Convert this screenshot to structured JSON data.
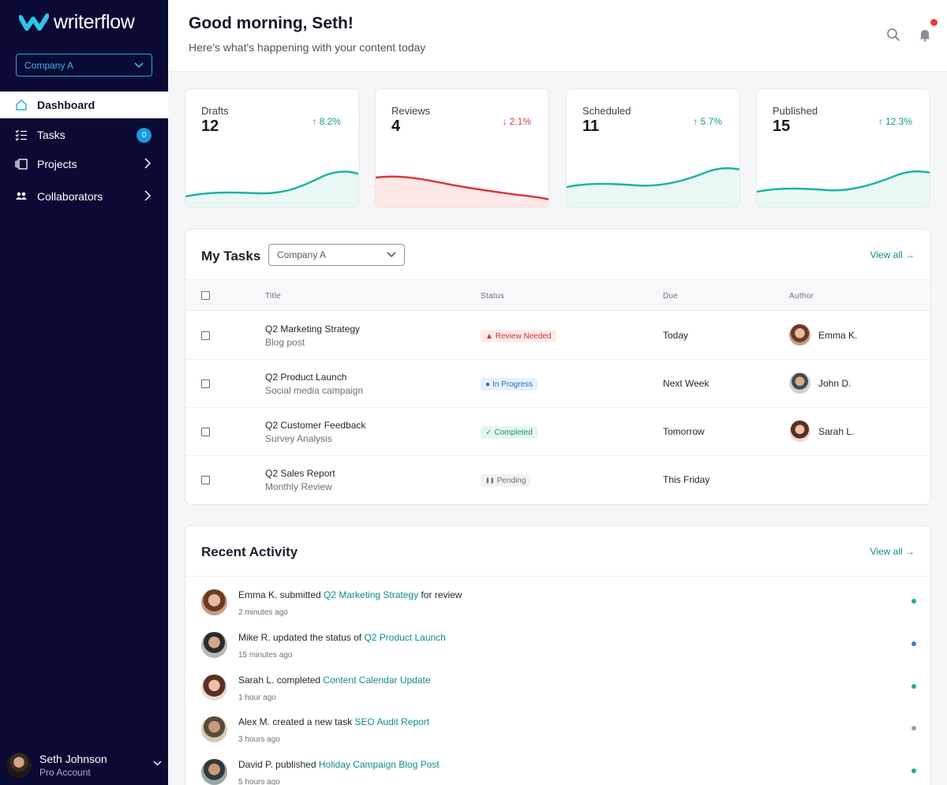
{
  "app": {
    "name": "writerflow"
  },
  "sidebar": {
    "company_select": "Company A",
    "items": [
      {
        "label": "Dashboard",
        "icon": "home-icon"
      },
      {
        "label": "Tasks",
        "icon": "checklist-icon",
        "badge": "0"
      },
      {
        "label": "Projects",
        "icon": "projects-icon"
      },
      {
        "label": "Collaborators",
        "icon": "users-icon"
      }
    ],
    "user": {
      "name": "Seth Johnson",
      "role": "Pro Account"
    }
  },
  "header": {
    "greeting": "Good morning, Seth!",
    "subtitle": "Here's what's happening with your content today"
  },
  "stats": [
    {
      "label": "Drafts",
      "value": "12",
      "change": "↑ 8.2%",
      "trend": "up",
      "color": "#1fb2a3"
    },
    {
      "label": "Reviews",
      "value": "4",
      "change": "↓ 2.1%",
      "trend": "down",
      "color": "#d93a3a"
    },
    {
      "label": "Scheduled",
      "value": "11",
      "change": "↑ 5.7%",
      "trend": "up",
      "color": "#1fb2a3"
    },
    {
      "label": "Published",
      "value": "15",
      "change": "↑ 12.3%",
      "trend": "up",
      "color": "#1fb2a3"
    }
  ],
  "tasks": {
    "title": "My Tasks",
    "filter": "Company A",
    "view_all": "View all →",
    "columns": [
      "Title",
      "Status",
      "Due",
      "Author"
    ],
    "rows": [
      {
        "title": "Q2 Marketing Strategy",
        "subtitle": "Blog post",
        "status": "Review Needed",
        "status_icon": "▲",
        "status_type": "review",
        "due": "Today",
        "author": "Emma K."
      },
      {
        "title": "Q2 Product Launch",
        "subtitle": "Social media campaign",
        "status": "In Progress",
        "status_icon": "●",
        "status_type": "progress",
        "due": "Next Week",
        "author": "John D."
      },
      {
        "title": "Q2 Customer Feedback",
        "subtitle": "Survey Analysis",
        "status": "Completed",
        "status_icon": "✓",
        "status_type": "completed",
        "due": "Tomorrow",
        "author": "Sarah L."
      },
      {
        "title": "Q2 Sales Report",
        "subtitle": "Monthly Review",
        "status": "Pending",
        "status_icon": "❚❚",
        "status_type": "pending",
        "due": "This Friday",
        "author": ""
      }
    ]
  },
  "activity": {
    "title": "Recent Activity",
    "view_all": "View all →",
    "items": [
      {
        "actor": "Emma K.",
        "action": " submitted ",
        "target": "Q2 Marketing Strategy",
        "suffix": " for review",
        "time": "2 minutes ago",
        "dot_color": "#19b38a"
      },
      {
        "actor": "Mike R.",
        "action": " updated the status of ",
        "target": "Q2 Product Launch",
        "suffix": "",
        "time": "15 minutes ago",
        "dot_color": "#3b7ddd"
      },
      {
        "actor": "Sarah L.",
        "action": " completed ",
        "target": "Content Calendar Update",
        "suffix": "",
        "time": "1 hour ago",
        "dot_color": "#19b38a"
      },
      {
        "actor": "Alex M.",
        "action": " created a new task ",
        "target": "SEO Audit Report",
        "suffix": "",
        "time": "3 hours ago",
        "dot_color": "#9a9fa8"
      },
      {
        "actor": "David P.",
        "action": " published ",
        "target": "Holiday Campaign Blog Post",
        "suffix": "",
        "time": "5 hours ago",
        "dot_color": "#19b38a"
      }
    ]
  }
}
